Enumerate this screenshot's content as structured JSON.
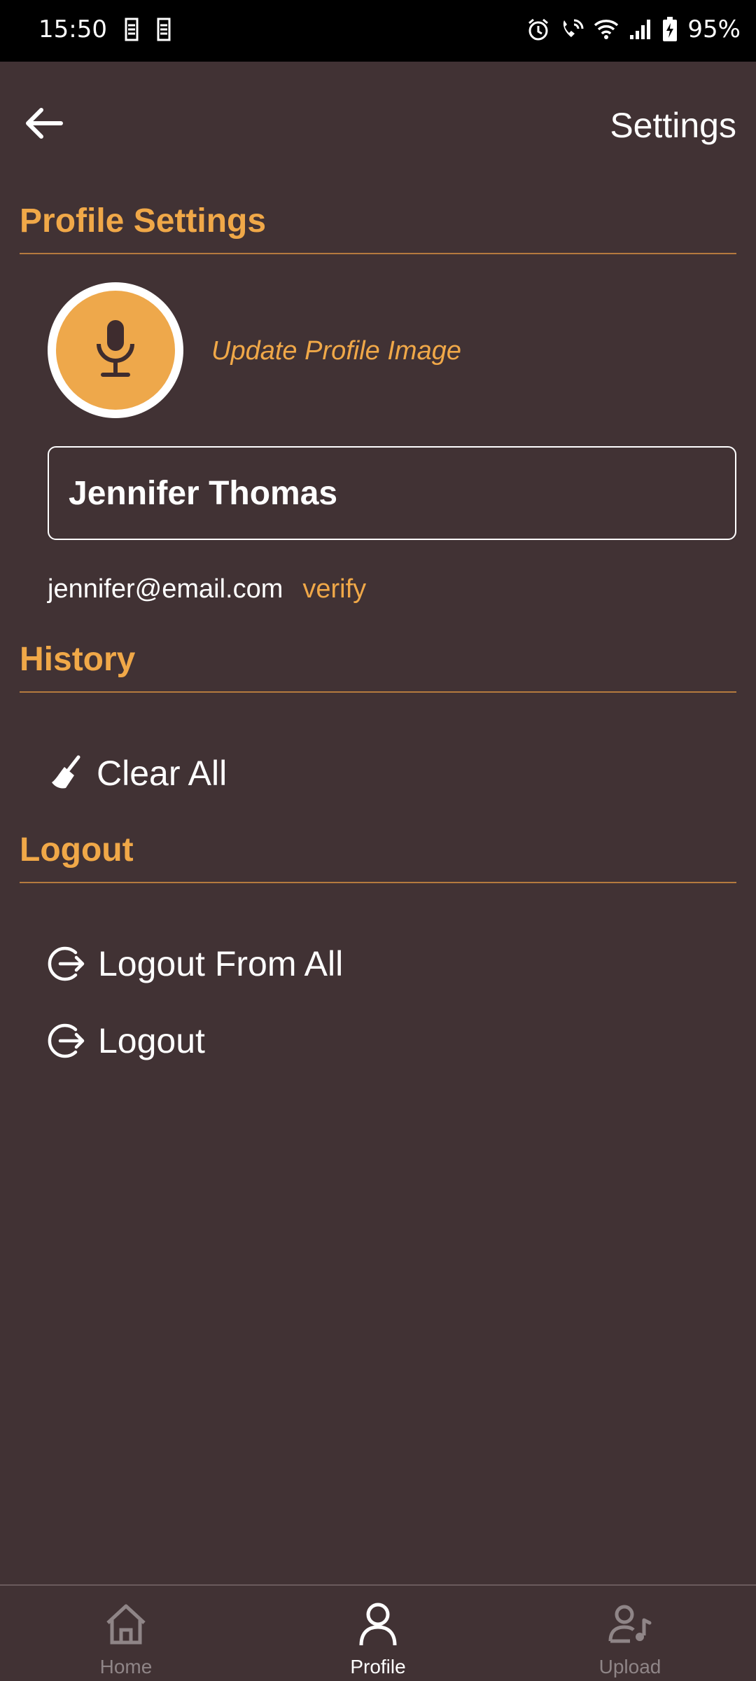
{
  "status_bar": {
    "time": "15:50",
    "battery": "95%",
    "icons": [
      "sim-icon",
      "sim-icon",
      "alarm-icon",
      "wifi-call-icon",
      "wifi-icon",
      "signal-icon",
      "battery-charging-icon"
    ]
  },
  "app_bar": {
    "title": "Settings",
    "back_icon": "arrow-left-icon"
  },
  "profile_section": {
    "heading": "Profile Settings",
    "avatar_icon": "microphone-icon",
    "update_image_label": "Update Profile Image",
    "name_value": "Jennifer Thomas",
    "email": "jennifer@email.com",
    "verify_label": "verify"
  },
  "history_section": {
    "heading": "History",
    "clear_all_label": "Clear All",
    "clear_icon": "broom-icon"
  },
  "logout_section": {
    "heading": "Logout",
    "logout_all_label": "Logout From All",
    "logout_label": "Logout",
    "logout_icon": "logout-icon"
  },
  "bottom_nav": {
    "items": [
      {
        "label": "Home",
        "icon": "home-icon",
        "active": false
      },
      {
        "label": "Profile",
        "icon": "person-icon",
        "active": true
      },
      {
        "label": "Upload",
        "icon": "user-music-icon",
        "active": false
      }
    ]
  },
  "colors": {
    "background": "#413234",
    "accent": "#f0a848",
    "text": "#ffffff",
    "inactive_nav": "#8f8587"
  }
}
